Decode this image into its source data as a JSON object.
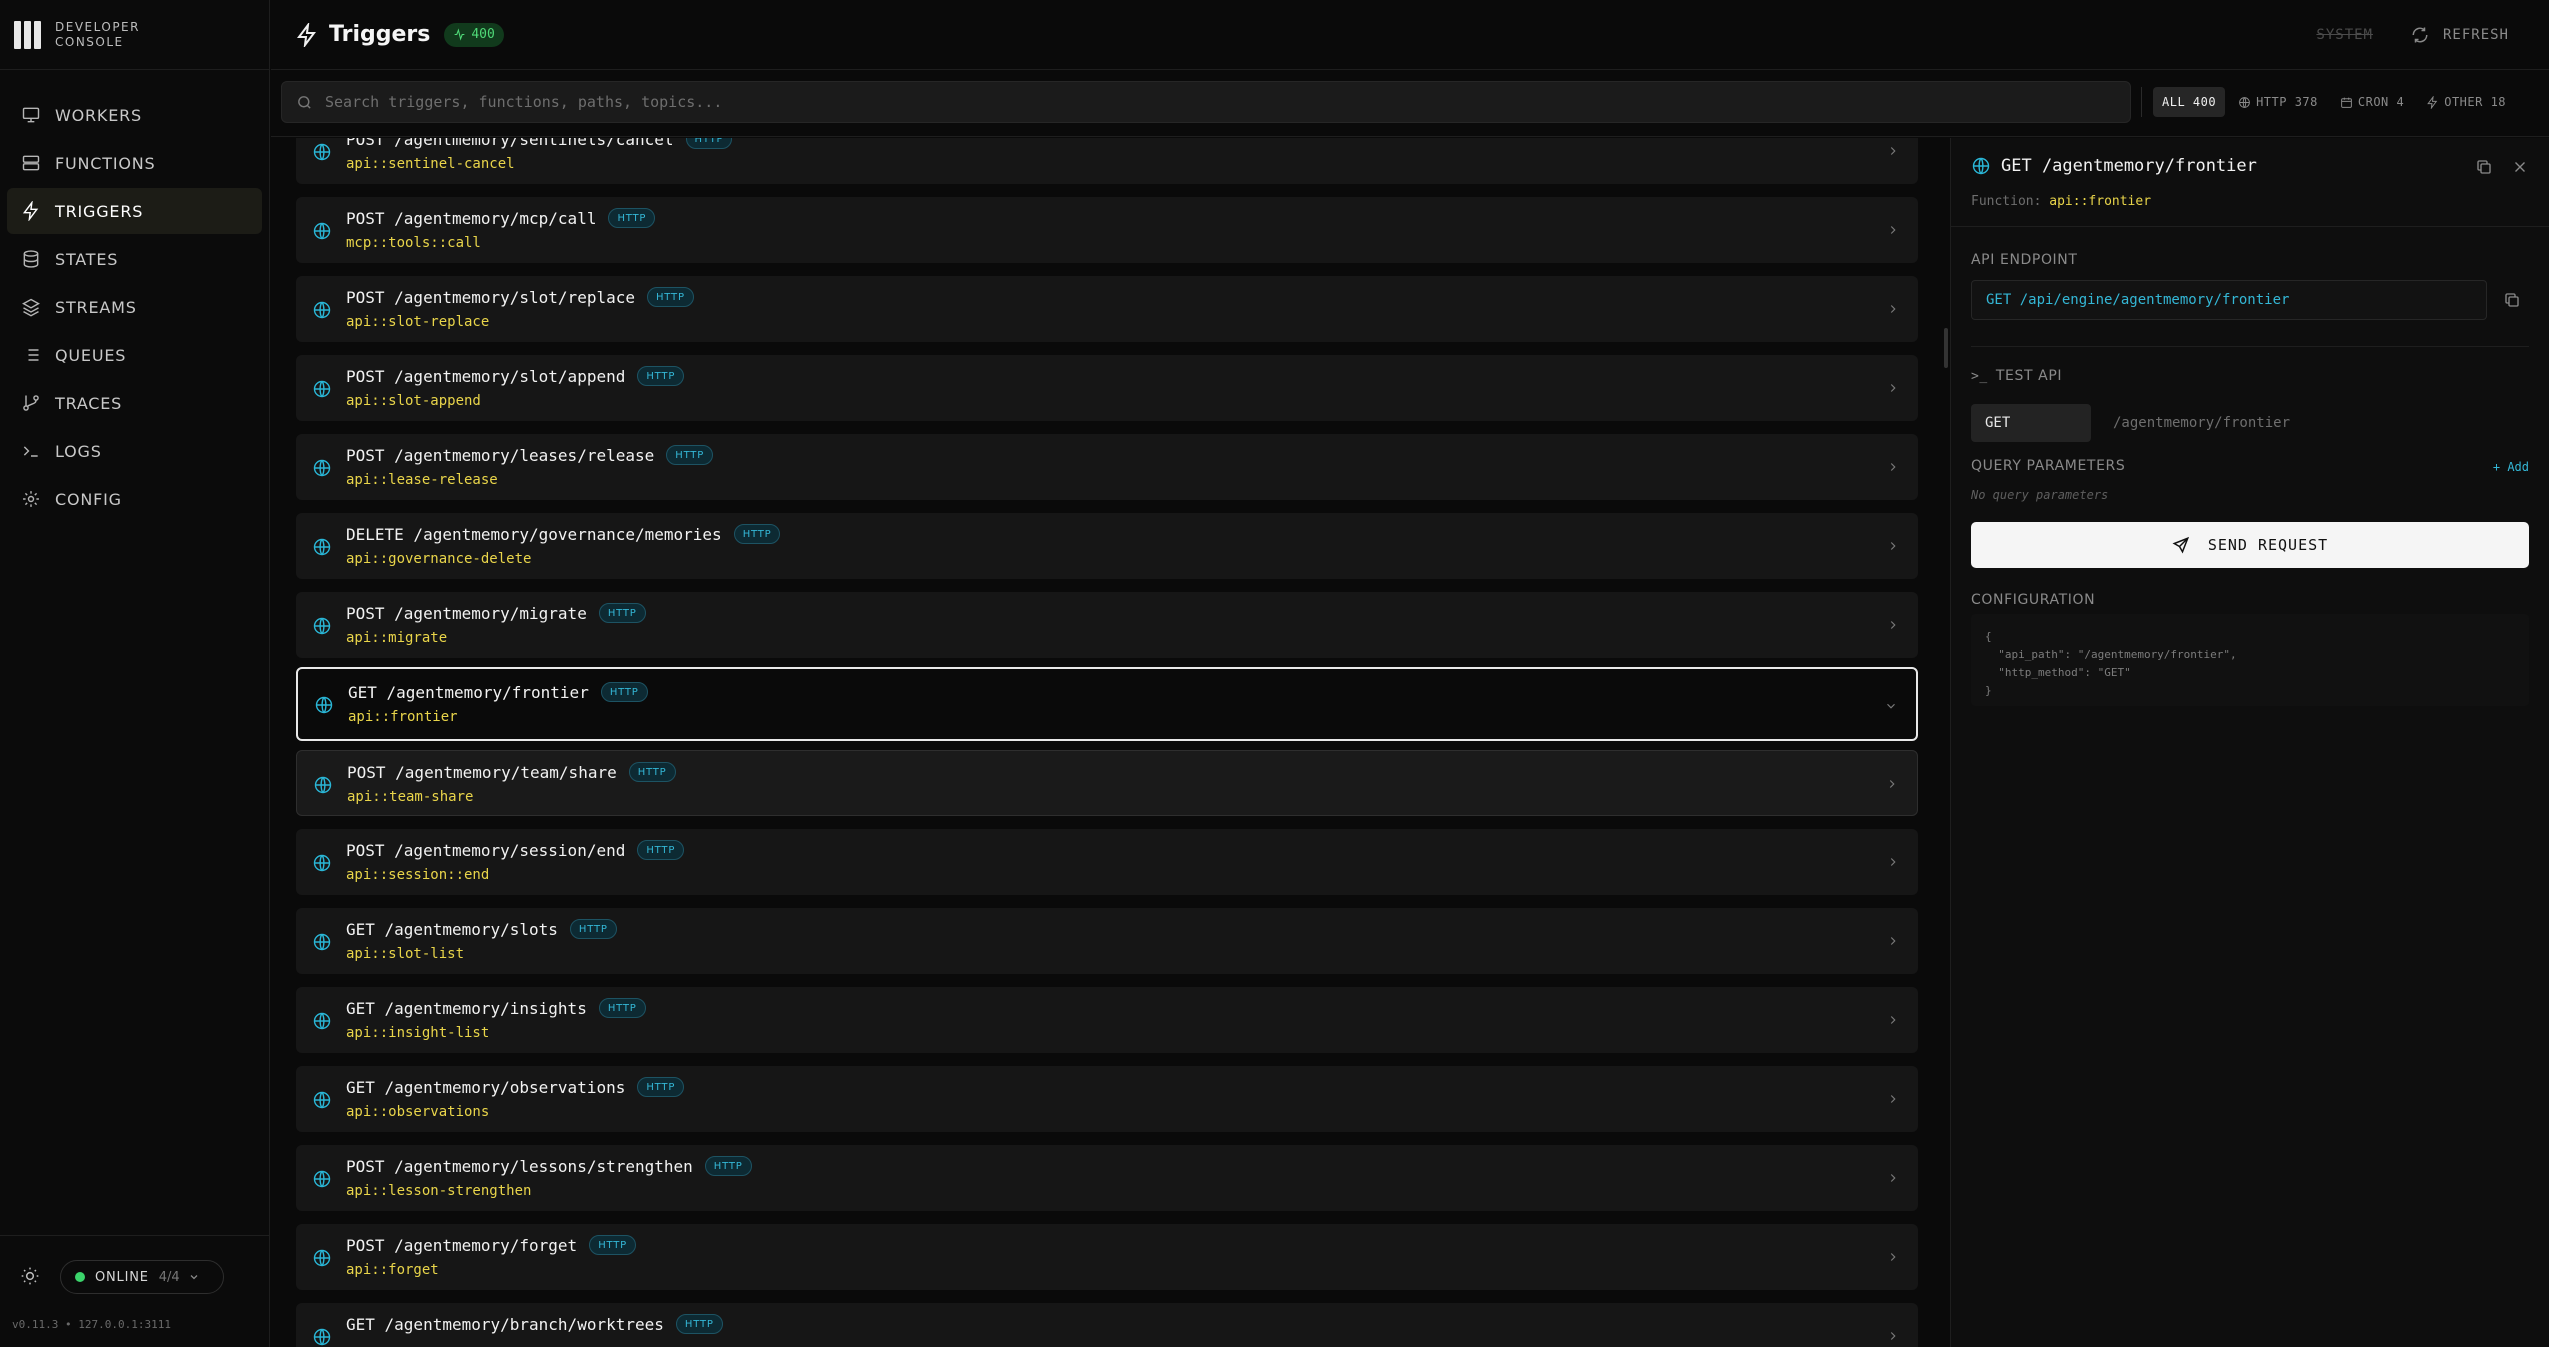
{
  "brand": {
    "line1": "DEVELOPER",
    "line2": "CONSOLE"
  },
  "sidebar": {
    "items": [
      {
        "label": "WORKERS",
        "icon": "monitor-icon"
      },
      {
        "label": "FUNCTIONS",
        "icon": "server-icon"
      },
      {
        "label": "TRIGGERS",
        "icon": "lightning-icon",
        "active": true
      },
      {
        "label": "STATES",
        "icon": "database-icon"
      },
      {
        "label": "STREAMS",
        "icon": "layers-icon"
      },
      {
        "label": "QUEUES",
        "icon": "list-icon"
      },
      {
        "label": "TRACES",
        "icon": "git-branch-icon"
      },
      {
        "label": "LOGS",
        "icon": "terminal-icon"
      },
      {
        "label": "CONFIG",
        "icon": "gear-icon"
      }
    ],
    "status": {
      "label": "ONLINE",
      "count": "4/4",
      "color": "#3bd46b"
    },
    "version": "v0.11.3 • 127.0.0.1:3111"
  },
  "header": {
    "title": "Triggers",
    "count": "400",
    "system_label": "SYSTEM",
    "refresh_label": "REFRESH"
  },
  "search": {
    "placeholder": "Search triggers, functions, paths, topics..."
  },
  "filters": [
    {
      "label": "ALL 400",
      "active": true
    },
    {
      "label": "HTTP 378",
      "icon": "globe-icon"
    },
    {
      "label": "CRON 4",
      "icon": "calendar-icon"
    },
    {
      "label": "OTHER 18",
      "icon": "lightning-icon"
    }
  ],
  "triggers": [
    {
      "path": "POST /agentmemory/sentinels/cancel",
      "type": "HTTP",
      "fn": "api::sentinel-cancel"
    },
    {
      "path": "POST /agentmemory/mcp/call",
      "type": "HTTP",
      "fn": "mcp::tools::call"
    },
    {
      "path": "POST /agentmemory/slot/replace",
      "type": "HTTP",
      "fn": "api::slot-replace"
    },
    {
      "path": "POST /agentmemory/slot/append",
      "type": "HTTP",
      "fn": "api::slot-append"
    },
    {
      "path": "POST /agentmemory/leases/release",
      "type": "HTTP",
      "fn": "api::lease-release"
    },
    {
      "path": "DELETE /agentmemory/governance/memories",
      "type": "HTTP",
      "fn": "api::governance-delete"
    },
    {
      "path": "POST /agentmemory/migrate",
      "type": "HTTP",
      "fn": "api::migrate"
    },
    {
      "path": "GET /agentmemory/frontier",
      "type": "HTTP",
      "fn": "api::frontier",
      "selected": true
    },
    {
      "path": "POST /agentmemory/team/share",
      "type": "HTTP",
      "fn": "api::team-share",
      "hover": true
    },
    {
      "path": "POST /agentmemory/session/end",
      "type": "HTTP",
      "fn": "api::session::end"
    },
    {
      "path": "GET /agentmemory/slots",
      "type": "HTTP",
      "fn": "api::slot-list"
    },
    {
      "path": "GET /agentmemory/insights",
      "type": "HTTP",
      "fn": "api::insight-list"
    },
    {
      "path": "GET /agentmemory/observations",
      "type": "HTTP",
      "fn": "api::observations"
    },
    {
      "path": "POST /agentmemory/lessons/strengthen",
      "type": "HTTP",
      "fn": "api::lesson-strengthen"
    },
    {
      "path": "POST /agentmemory/forget",
      "type": "HTTP",
      "fn": "api::forget"
    },
    {
      "path": "GET /agentmemory/branch/worktrees",
      "type": "HTTP",
      "fn": ""
    }
  ],
  "detail": {
    "title": "GET /agentmemory/frontier",
    "function_label": "Function:",
    "function_value": "api::frontier",
    "api_endpoint_label": "API ENDPOINT",
    "api_endpoint_value": "GET /api/engine/agentmemory/frontier",
    "test_api_label": "TEST API",
    "method": "GET",
    "path_placeholder": "/agentmemory/frontier",
    "query_params_label": "QUERY PARAMETERS",
    "add_label": "+ Add",
    "no_params": "No query parameters",
    "send_label": "SEND REQUEST",
    "configuration_label": "CONFIGURATION",
    "configuration_json": "{\n  \"api_path\": \"/agentmemory/frontier\",\n  \"http_method\": \"GET\"\n}"
  },
  "colors": {
    "accent_cyan": "#34b7d6",
    "function_yellow": "#e9d54a",
    "online_green": "#3bd46b"
  }
}
